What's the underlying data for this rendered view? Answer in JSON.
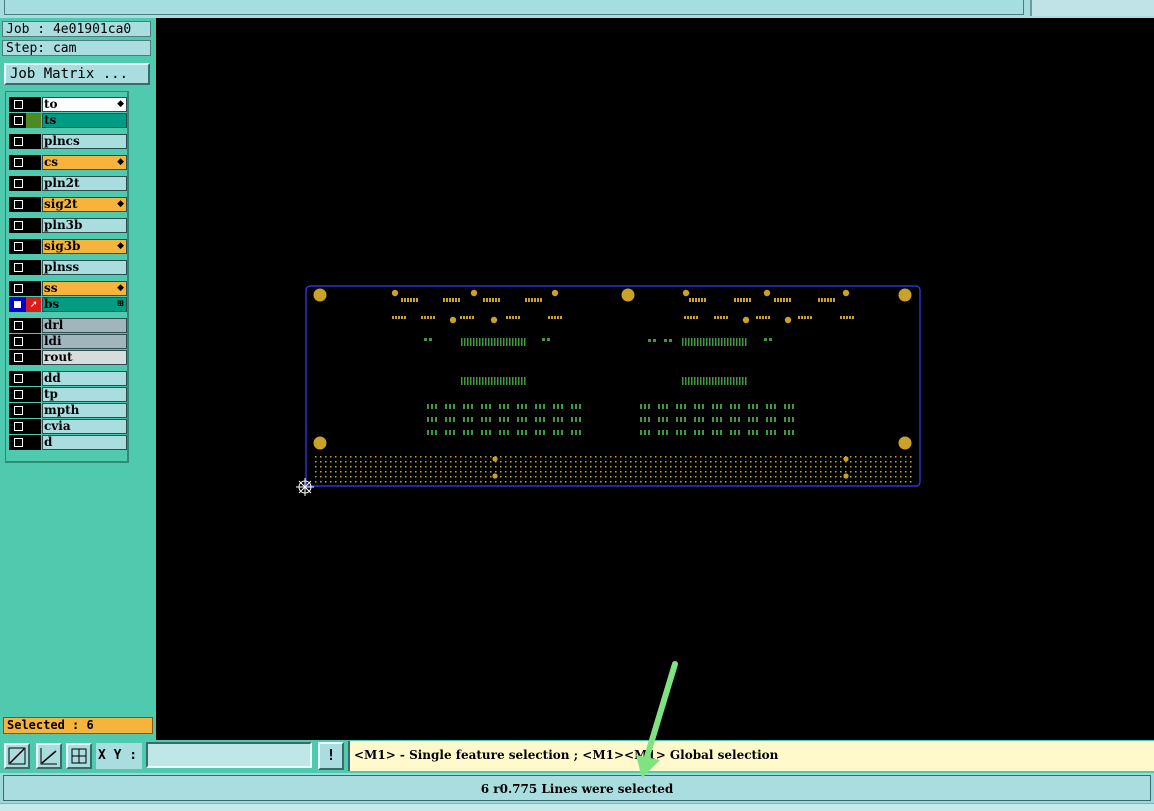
{
  "sidebar": {
    "job_label": "Job : 4e01901ca0",
    "step_label": "Step: cam",
    "job_matrix_button": "Job Matrix ...",
    "selected_label": "Selected : 6"
  },
  "layers": [
    {
      "name": "to",
      "color": "#ffffff",
      "checkbox": "black",
      "swatch": "black",
      "mark": "◆"
    },
    {
      "name": "ts",
      "color": "#009c84",
      "checkbox": "black",
      "swatch": "green",
      "mark": ""
    },
    {
      "name": "plncs",
      "color": "#a9dde0",
      "checkbox": "black",
      "swatch": "black",
      "mark": ""
    },
    {
      "name": "cs",
      "color": "#f6b43c",
      "checkbox": "black",
      "swatch": "black",
      "mark": "◆"
    },
    {
      "name": "pln2t",
      "color": "#a9dde0",
      "checkbox": "black",
      "swatch": "black",
      "mark": ""
    },
    {
      "name": "sig2t",
      "color": "#f6b43c",
      "checkbox": "black",
      "swatch": "black",
      "mark": "◆"
    },
    {
      "name": "pln3b",
      "color": "#a9dde0",
      "checkbox": "black",
      "swatch": "black",
      "mark": ""
    },
    {
      "name": "sig3b",
      "color": "#f6b43c",
      "checkbox": "black",
      "swatch": "black",
      "mark": "◆"
    },
    {
      "name": "plnss",
      "color": "#a9dde0",
      "checkbox": "black",
      "swatch": "black",
      "mark": ""
    },
    {
      "name": "ss",
      "color": "#f6b43c",
      "checkbox": "black",
      "swatch": "black",
      "mark": "◆"
    },
    {
      "name": "bs",
      "color": "#009c84",
      "checkbox": "blue",
      "swatch": "red",
      "mark": "⊞"
    },
    {
      "name": "drl",
      "color": "#9fb6bd",
      "checkbox": "black",
      "swatch": "black",
      "mark": ""
    },
    {
      "name": "ldi",
      "color": "#9fb6bd",
      "checkbox": "black",
      "swatch": "black",
      "mark": ""
    },
    {
      "name": "rout",
      "color": "#d7dcdc",
      "checkbox": "black",
      "swatch": "black",
      "mark": ""
    },
    {
      "name": "dd",
      "color": "#a9dde0",
      "checkbox": "black",
      "swatch": "black",
      "mark": ""
    },
    {
      "name": "tp",
      "color": "#a9dde0",
      "checkbox": "black",
      "swatch": "black",
      "mark": ""
    },
    {
      "name": "mpth",
      "color": "#a9dde0",
      "checkbox": "black",
      "swatch": "black",
      "mark": ""
    },
    {
      "name": "cvia",
      "color": "#a9dde0",
      "checkbox": "black",
      "swatch": "black",
      "mark": ""
    },
    {
      "name": "d",
      "color": "#a9dde0",
      "checkbox": "black",
      "swatch": "black",
      "mark": ""
    }
  ],
  "toolbar": {
    "xy_label": "X Y :",
    "xy_value": "",
    "bang_label": "!",
    "hint": "<M1> - Single feature selection ; <M1><M1> Global selection"
  },
  "status": {
    "message": "6 r0.775 Lines were selected"
  },
  "colors": {
    "panel": "#4fcaaf",
    "board_outline": "#3b3bff",
    "pad": "#c9a227",
    "trace": "#3f9a3f",
    "arrow": "#7fe37f"
  },
  "icons": {
    "toolbar": [
      "zoom-fit-icon",
      "measure-icon",
      "snap-grid-icon"
    ],
    "datum": "datum-target-icon"
  }
}
